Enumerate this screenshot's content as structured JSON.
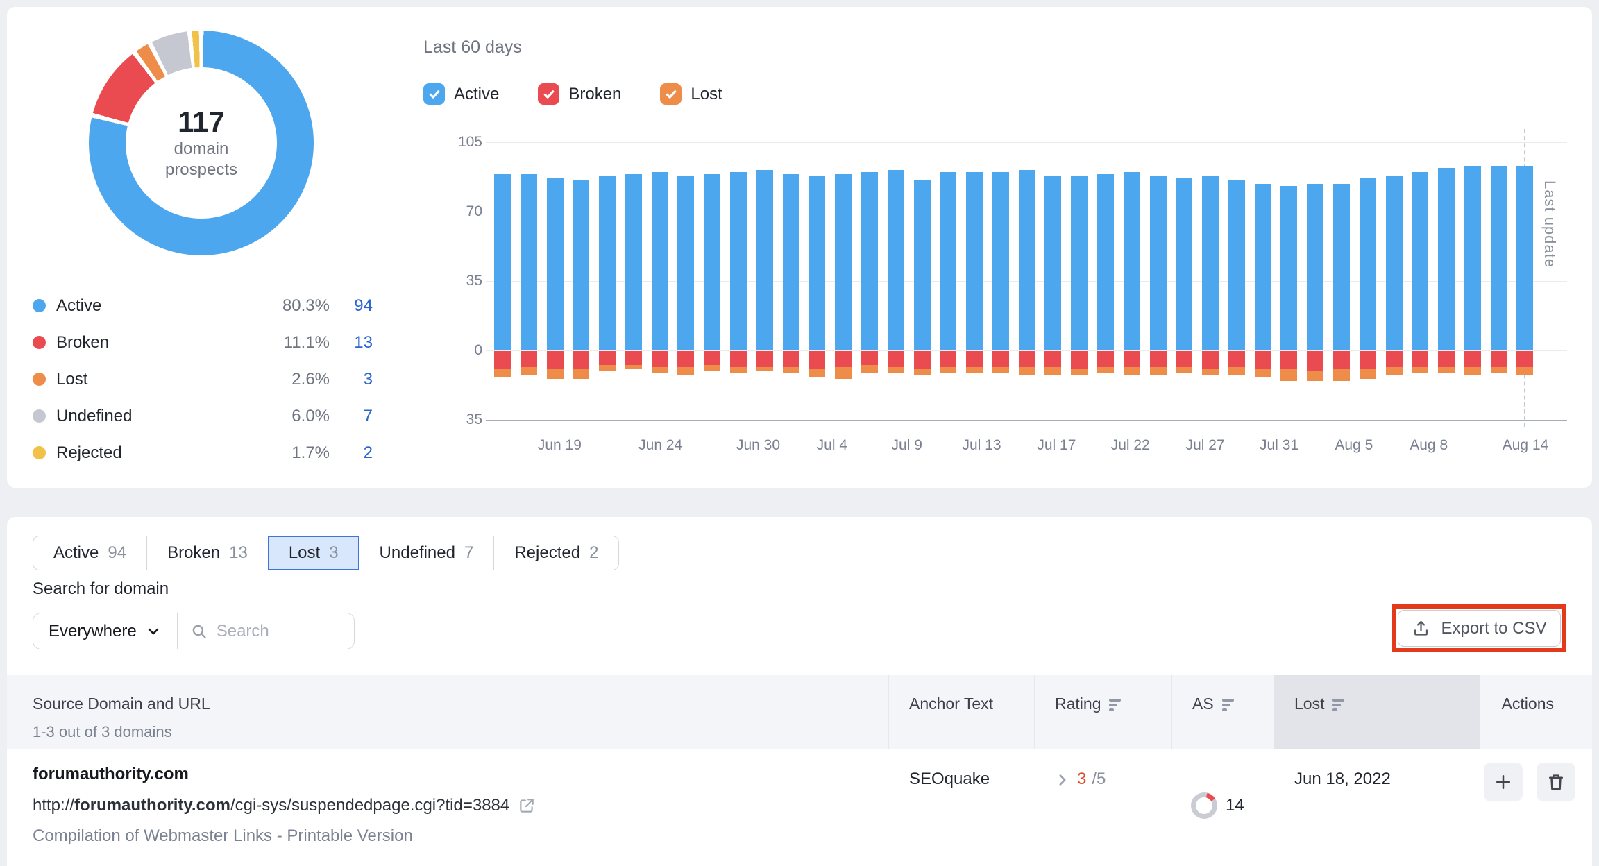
{
  "donut": {
    "total": "117",
    "total_label_1": "domain",
    "total_label_2": "prospects",
    "segments": [
      {
        "label": "Active",
        "pct": "80.3%",
        "count": "94",
        "color": "#4da7ee",
        "value": 80.3
      },
      {
        "label": "Broken",
        "pct": "11.1%",
        "count": "13",
        "color": "#ea4b50",
        "value": 11.1
      },
      {
        "label": "Lost",
        "pct": "2.6%",
        "count": "3",
        "color": "#ee8c49",
        "value": 2.6
      },
      {
        "label": "Undefined",
        "pct": "6.0%",
        "count": "7",
        "color": "#c5c8d0",
        "value": 6.0
      },
      {
        "label": "Rejected",
        "pct": "1.7%",
        "count": "2",
        "color": "#f0c24a",
        "value": 1.7
      }
    ]
  },
  "trend": {
    "title": "Last 60 days",
    "filters": [
      {
        "label": "Active",
        "color": "#4da7ee",
        "checked": true
      },
      {
        "label": "Broken",
        "color": "#ea4b50",
        "checked": true
      },
      {
        "label": "Lost",
        "color": "#ee8c49",
        "checked": true
      }
    ],
    "last_update_label": "Last update"
  },
  "chart_data": [
    {
      "type": "pie",
      "title": "117 domain prospects",
      "labels": [
        "Active",
        "Broken",
        "Lost",
        "Undefined",
        "Rejected"
      ],
      "values": [
        80.3,
        11.1,
        2.6,
        6.0,
        1.7
      ],
      "counts": [
        94,
        13,
        3,
        7,
        2
      ],
      "colors": [
        "#4da7ee",
        "#ea4b50",
        "#ee8c49",
        "#c5c8d0",
        "#f0c24a"
      ],
      "style": "donut"
    },
    {
      "type": "bar",
      "subtype": "stacked, Broken and Lost plotted below zero",
      "title": "Last 60 days",
      "ylim": [
        -35,
        105
      ],
      "y_ticks": [
        105,
        70,
        35,
        0,
        -35
      ],
      "x_ticks": [
        {
          "label": "Jun 19",
          "pos": 6.3
        },
        {
          "label": "Jun 24",
          "pos": 16.0
        },
        {
          "label": "Jun 30",
          "pos": 25.4
        },
        {
          "label": "Jul 4",
          "pos": 32.5
        },
        {
          "label": "Jul 9",
          "pos": 39.7
        },
        {
          "label": "Jul 13",
          "pos": 46.9
        },
        {
          "label": "Jul 17",
          "pos": 54.1
        },
        {
          "label": "Jul 22",
          "pos": 61.2
        },
        {
          "label": "Jul 27",
          "pos": 68.4
        },
        {
          "label": "Jul 31",
          "pos": 75.5
        },
        {
          "label": "Aug 5",
          "pos": 82.7
        },
        {
          "label": "Aug 8",
          "pos": 89.9
        },
        {
          "label": "Aug 14",
          "pos": 99.2
        }
      ],
      "series": [
        {
          "name": "Active",
          "color": "#4da7ee",
          "values": [
            89,
            89,
            87,
            86,
            88,
            89,
            90,
            88,
            89,
            90,
            91,
            89,
            88,
            89,
            90,
            91,
            86,
            90,
            90,
            90,
            91,
            88,
            88,
            89,
            90,
            88,
            87,
            88,
            86,
            84,
            83,
            84,
            84,
            87,
            88,
            90,
            92,
            93,
            93,
            93
          ]
        },
        {
          "name": "Broken",
          "color": "#ea4b50",
          "values": [
            9,
            8,
            9,
            9,
            7,
            7,
            8,
            8,
            7,
            8,
            8,
            8,
            9,
            8,
            7,
            8,
            9,
            8,
            8,
            8,
            8,
            8,
            9,
            8,
            8,
            8,
            8,
            9,
            8,
            9,
            9,
            10,
            9,
            9,
            8,
            8,
            8,
            8,
            8,
            8
          ]
        },
        {
          "name": "Lost",
          "color": "#ee8c49",
          "values": [
            4,
            4,
            5,
            5,
            3,
            2,
            3,
            4,
            3,
            3,
            2,
            3,
            4,
            6,
            4,
            3,
            3,
            3,
            3,
            3,
            4,
            4,
            3,
            3,
            4,
            4,
            3,
            3,
            4,
            4,
            6,
            5,
            6,
            5,
            4,
            3,
            3,
            4,
            3,
            4
          ]
        }
      ]
    }
  ],
  "tabs": [
    {
      "label": "Active",
      "count": "94",
      "selected": false
    },
    {
      "label": "Broken",
      "count": "13",
      "selected": false
    },
    {
      "label": "Lost",
      "count": "3",
      "selected": true
    },
    {
      "label": "Undefined",
      "count": "7",
      "selected": false
    },
    {
      "label": "Rejected",
      "count": "2",
      "selected": false
    }
  ],
  "search": {
    "label": "Search for domain",
    "scope": "Everywhere",
    "placeholder": "Search"
  },
  "export": {
    "label": "Export to CSV"
  },
  "table": {
    "columns": {
      "source": "Source Domain and URL",
      "source_sub": "1-3 out of 3 domains",
      "anchor": "Anchor Text",
      "rating": "Rating",
      "as": "AS",
      "lost": "Lost",
      "actions": "Actions"
    },
    "rows": [
      {
        "domain": "forumauthority.com",
        "url_prefix": "http://",
        "url_domain": "forumauthority.com",
        "url_path": "/cgi-sys/suspendedpage.cgi?tid=3884",
        "page_title": "Compilation of Webmaster Links - Printable Version",
        "anchor_text": "SEOquake",
        "rating_value": "3",
        "rating_max": "/5",
        "as_value": "14",
        "lost_date": "Jun 18, 2022"
      }
    ]
  }
}
